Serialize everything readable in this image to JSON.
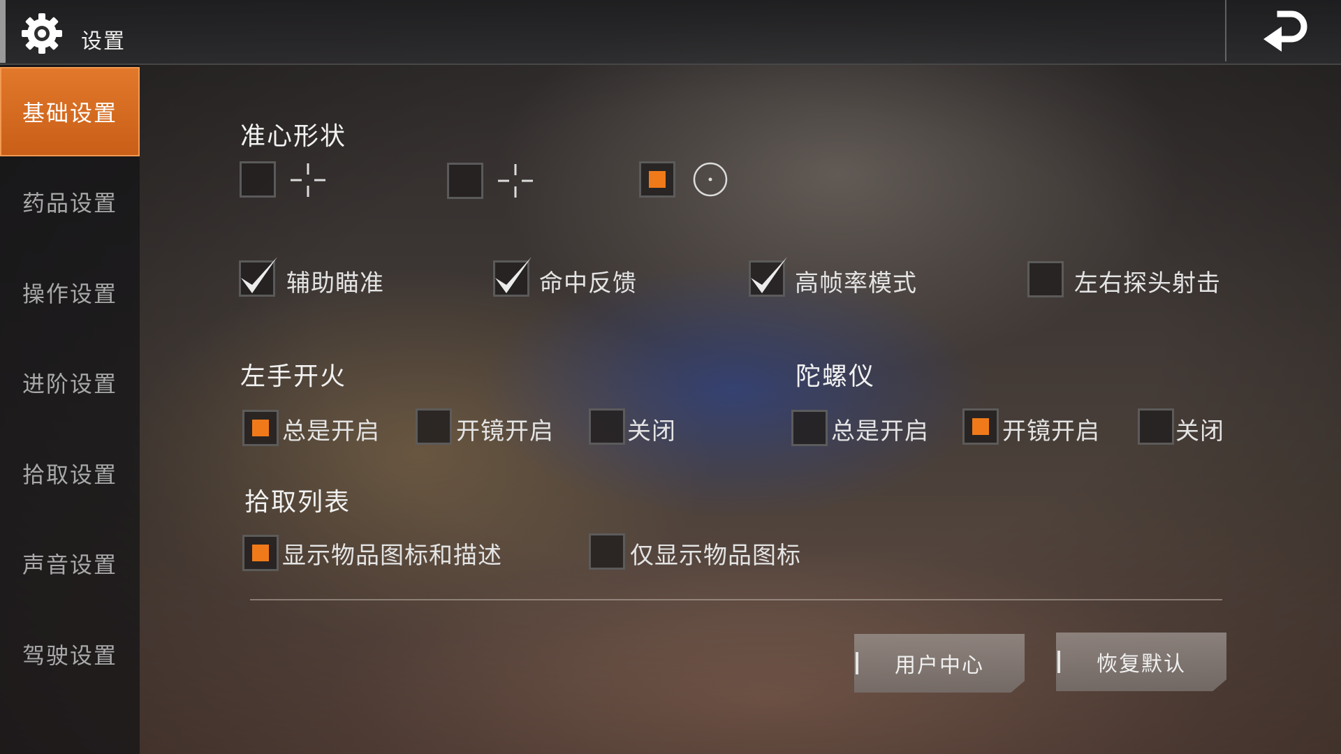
{
  "header": {
    "title": "设置",
    "icons": {
      "settings": "gear-icon",
      "back": "back-arrow-icon"
    }
  },
  "sidebar": {
    "items": [
      {
        "label": "基础设置",
        "active": true
      },
      {
        "label": "药品设置",
        "active": false
      },
      {
        "label": "操作设置",
        "active": false
      },
      {
        "label": "进阶设置",
        "active": false
      },
      {
        "label": "拾取设置",
        "active": false
      },
      {
        "label": "声音设置",
        "active": false
      },
      {
        "label": "驾驶设置",
        "active": false
      }
    ]
  },
  "crosshair": {
    "title": "准心形状",
    "options": [
      {
        "icon": "crosshair-cross-icon",
        "selected": false
      },
      {
        "icon": "crosshair-cross-icon",
        "selected": false
      },
      {
        "icon": "crosshair-dot-circle-icon",
        "selected": true
      }
    ]
  },
  "toggles": [
    {
      "label": "辅助瞄准",
      "checked": true
    },
    {
      "label": "命中反馈",
      "checked": true
    },
    {
      "label": "高帧率模式",
      "checked": true
    },
    {
      "label": "左右探头射击",
      "checked": false
    }
  ],
  "left_fire": {
    "title": "左手开火",
    "options": [
      {
        "label": "总是开启",
        "selected": true
      },
      {
        "label": "开镜开启",
        "selected": false
      },
      {
        "label": "关闭",
        "selected": false
      }
    ]
  },
  "gyroscope": {
    "title": "陀螺仪",
    "options": [
      {
        "label": "总是开启",
        "selected": false
      },
      {
        "label": "开镜开启",
        "selected": true
      },
      {
        "label": "关闭",
        "selected": false
      }
    ]
  },
  "pickup_list": {
    "title": "拾取列表",
    "options": [
      {
        "label": "显示物品图标和描述",
        "selected": true
      },
      {
        "label": "仅显示物品图标",
        "selected": false
      }
    ]
  },
  "buttons": {
    "user_center": "用户中心",
    "restore_default": "恢复默认"
  },
  "colors": {
    "accent": "#e2782a",
    "selected_fill": "#f07a1a"
  }
}
